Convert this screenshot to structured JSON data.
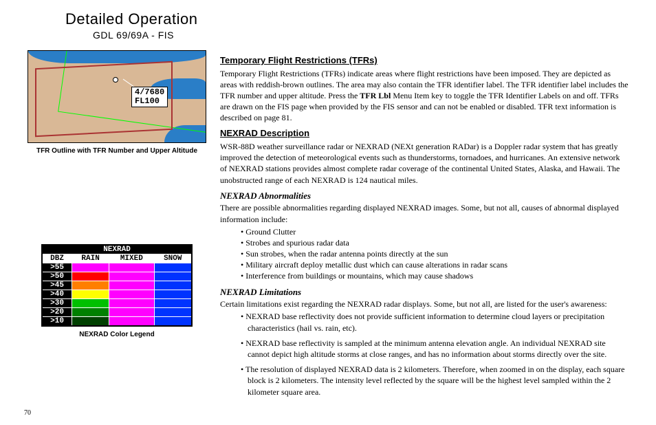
{
  "header": {
    "title": "Detailed Operation",
    "subtitle": "GDL 69/69A - FIS"
  },
  "page_number": "70",
  "left": {
    "tfr_caption": "TFR Outline with TFR Number and Upper Altitude",
    "tfr_label_line1": "4/7680",
    "tfr_label_line2": "FL100",
    "nexrad_caption": "NEXRAD Color Legend",
    "nexrad_title": "NEXRAD",
    "nexrad_headers": {
      "c0": "DBZ",
      "c1": "RAIN",
      "c2": "MIXED",
      "c3": "SNOW"
    },
    "nexrad_rows": [
      {
        "dbz": ">55",
        "rain": "#ff00ff",
        "mixed": "#ff00ff",
        "snow": "#0033ff"
      },
      {
        "dbz": ">50",
        "rain": "#ff0000",
        "mixed": "#ff00ff",
        "snow": "#0033ff"
      },
      {
        "dbz": ">45",
        "rain": "#ff7f00",
        "mixed": "#ff00ff",
        "snow": "#0033ff"
      },
      {
        "dbz": ">40",
        "rain": "#ffff00",
        "mixed": "#ff00ff",
        "snow": "#0033ff"
      },
      {
        "dbz": ">30",
        "rain": "#00c000",
        "mixed": "#ff00ff",
        "snow": "#0033ff"
      },
      {
        "dbz": ">20",
        "rain": "#008000",
        "mixed": "#ff00ff",
        "snow": "#0033ff"
      },
      {
        "dbz": ">10",
        "rain": "#004000",
        "mixed": "#ff00ff",
        "snow": "#0033ff"
      }
    ]
  },
  "right": {
    "s1_title": "Temporary Flight Restrictions (TFRs)",
    "s1_p1a": "Temporary Flight Restrictions (TFRs) indicate areas where flight restrictions have been imposed. They are depicted as areas with reddish-brown outlines. The area may also contain the TFR identifier label. The TFR identifier label includes the TFR number and upper altitude. Press the ",
    "s1_bold": "TFR Lbl",
    "s1_p1b": " Menu Item key to toggle the TFR Identifier Labels on and off. TFRs are drawn on the FIS page when provided by the FIS sensor and can not be enabled or disabled. TFR text information is described on page 81.",
    "s2_title": "NEXRAD Description",
    "s2_p1": "WSR-88D weather surveillance radar or NEXRAD (NEXt generation RADar) is a Doppler radar system that has greatly improved the detection of meteorological events such as thunderstorms, tornadoes, and hurricanes. An extensive network of NEXRAD stations provides almost complete radar coverage of the continental United States, Alaska, and Hawaii. The unobstructed range of each NEXRAD is 124 nautical miles.",
    "s3_title": "NEXRAD Abnormalities",
    "s3_p1": "There are possible abnormalities regarding displayed NEXRAD images. Some, but not all, causes of abnormal displayed information include:",
    "s3_bullets": {
      "b0": "Ground Clutter",
      "b1": "Strobes and spurious radar data",
      "b2": "Sun strobes, when the radar antenna points directly at the sun",
      "b3": "Military aircraft deploy metallic dust which can cause alterations in radar scans",
      "b4": "Interference from buildings or mountains, which may cause shadows"
    },
    "s4_title": "NEXRAD Limitations",
    "s4_p1": "Certain limitations exist regarding the NEXRAD radar displays. Some, but not all, are listed for the user's awareness:",
    "s4_bullets": {
      "b0": "NEXRAD base reflectivity does not provide sufficient information to determine cloud layers or precipitation characteristics (hail vs. rain, etc).",
      "b1": "NEXRAD base reflectivity is sampled at the minimum antenna elevation angle. An individual NEXRAD site cannot depict high altitude storms at close ranges, and has no information about storms directly over the site.",
      "b2": "The resolution of displayed NEXRAD data is 2 kilometers. Therefore, when zoomed in on the  display, each square block is 2 kilometers. The intensity level reflected by the square will be the highest level sampled within the 2 kilometer square area."
    }
  }
}
